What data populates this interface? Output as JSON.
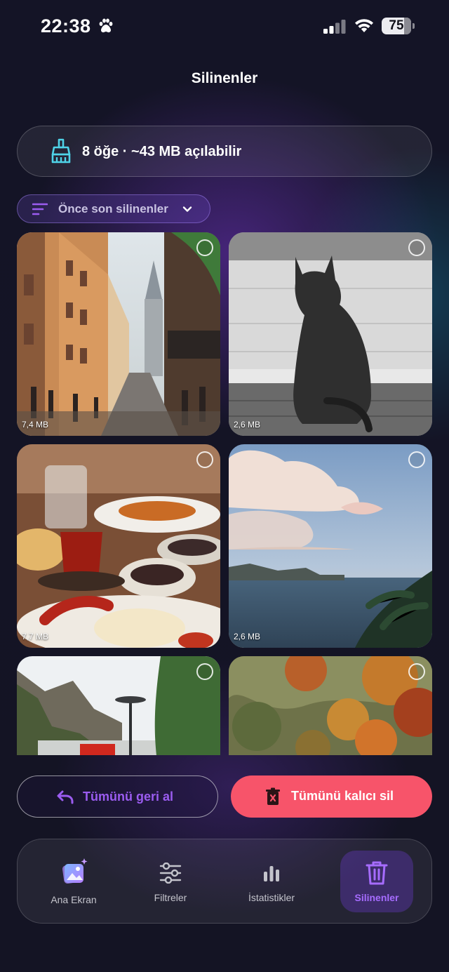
{
  "status_bar": {
    "time": "22:38",
    "battery": "75",
    "icons": [
      "paw-icon",
      "signal-icon",
      "wifi-icon",
      "battery-icon"
    ]
  },
  "header": {
    "title": "Silinenler"
  },
  "summary": {
    "text": "8 öğe · ~43 MB açılabilir",
    "icon": "broom-icon"
  },
  "sort": {
    "label": "Önce son silinenler",
    "icon": "sort-lines-icon",
    "chevron": "chevron-down-icon"
  },
  "photos": [
    {
      "subject": "galata-street",
      "size": "7,4 MB"
    },
    {
      "subject": "cat-window",
      "size": "2,6 MB"
    },
    {
      "subject": "breakfast-tea",
      "size": "7,7 MB"
    },
    {
      "subject": "sea-clouds",
      "size": "2,6 MB"
    },
    {
      "subject": "road-mountains",
      "size": ""
    },
    {
      "subject": "autumn-forest",
      "size": ""
    }
  ],
  "actions": {
    "restore_all": "Tümünü geri al",
    "delete_all": "Tümünü kalıcı sil"
  },
  "nav": {
    "items": [
      {
        "label": "Ana Ekran",
        "icon": "gallery-sparkle-icon"
      },
      {
        "label": "Filtreler",
        "icon": "sliders-icon"
      },
      {
        "label": "İstatistikler",
        "icon": "bar-chart-icon"
      },
      {
        "label": "Silinenler",
        "icon": "trash-icon",
        "active": true
      }
    ]
  },
  "colors": {
    "accent": "#9b5cf0",
    "danger": "#f7546a",
    "broom": "#4fd3e8"
  }
}
